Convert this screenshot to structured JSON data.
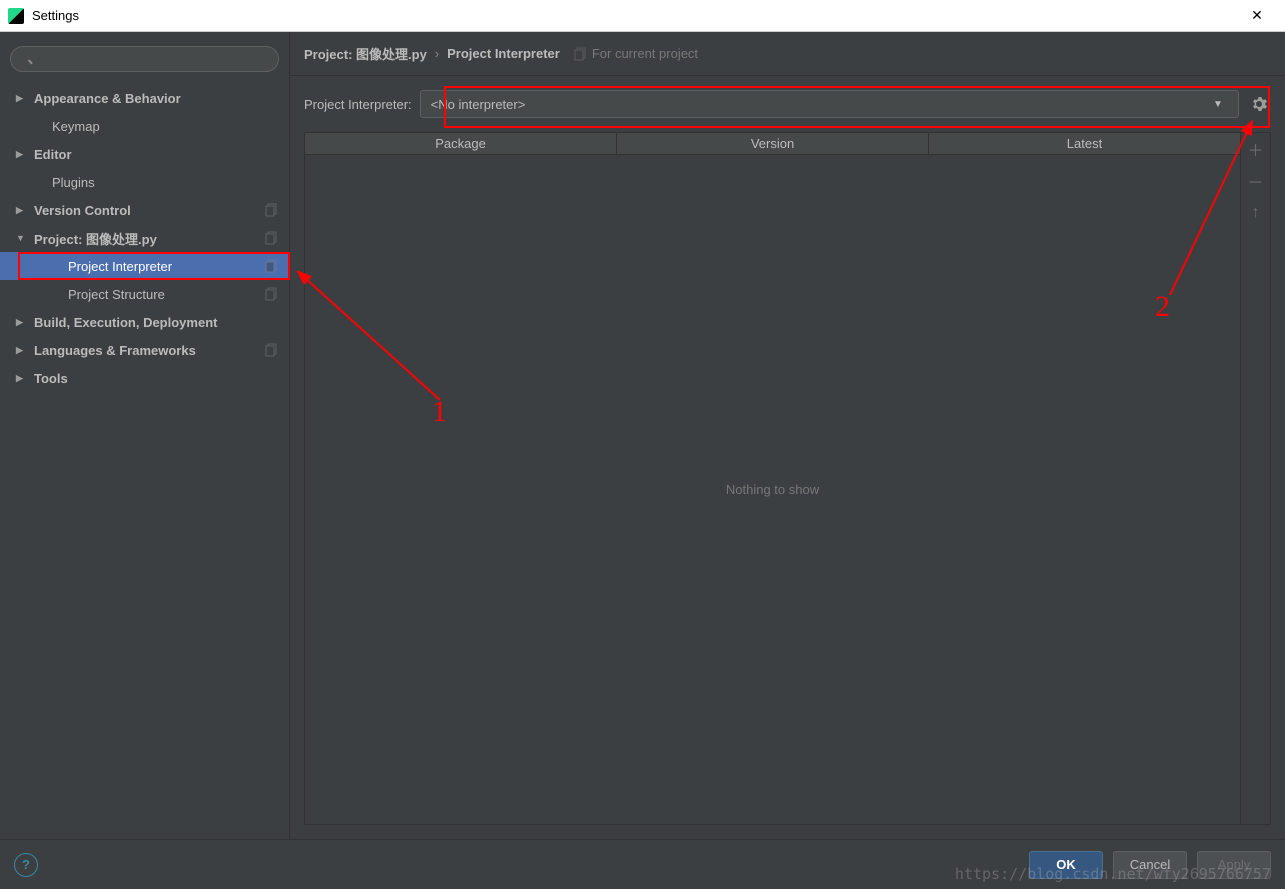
{
  "window": {
    "title": "Settings"
  },
  "sidebar": {
    "search_placeholder": "",
    "items": [
      {
        "label": "Appearance & Behavior",
        "arrow": "right",
        "bold": true,
        "child": false,
        "copy": false
      },
      {
        "label": "Keymap",
        "arrow": "none",
        "bold": false,
        "child": false,
        "copy": false,
        "indent": 34
      },
      {
        "label": "Editor",
        "arrow": "right",
        "bold": true,
        "child": false,
        "copy": false
      },
      {
        "label": "Plugins",
        "arrow": "none",
        "bold": false,
        "child": false,
        "copy": false,
        "indent": 34
      },
      {
        "label": "Version Control",
        "arrow": "right",
        "bold": true,
        "child": false,
        "copy": true
      },
      {
        "label": "Project: 图像处理.py",
        "arrow": "down",
        "bold": true,
        "child": false,
        "copy": true
      },
      {
        "label": "Project Interpreter",
        "arrow": "none",
        "bold": false,
        "child": true,
        "copy": true,
        "selected": true
      },
      {
        "label": "Project Structure",
        "arrow": "none",
        "bold": false,
        "child": true,
        "copy": true
      },
      {
        "label": "Build, Execution, Deployment",
        "arrow": "right",
        "bold": true,
        "child": false,
        "copy": false
      },
      {
        "label": "Languages & Frameworks",
        "arrow": "right",
        "bold": true,
        "child": false,
        "copy": true
      },
      {
        "label": "Tools",
        "arrow": "right",
        "bold": true,
        "child": false,
        "copy": false
      }
    ]
  },
  "breadcrumb": {
    "crumb1": "Project: 图像处理.py",
    "crumb2": "Project Interpreter",
    "note": "For current project"
  },
  "interpreter": {
    "label": "Project Interpreter:",
    "value": "<No interpreter>"
  },
  "table": {
    "columns": [
      "Package",
      "Version",
      "Latest"
    ],
    "empty": "Nothing to show"
  },
  "buttons": {
    "ok": "OK",
    "cancel": "Cancel",
    "apply": "Apply"
  },
  "annotations": {
    "n1": "1",
    "n2": "2"
  },
  "watermark": "https://blog.csdn.net/wfy2695766757"
}
